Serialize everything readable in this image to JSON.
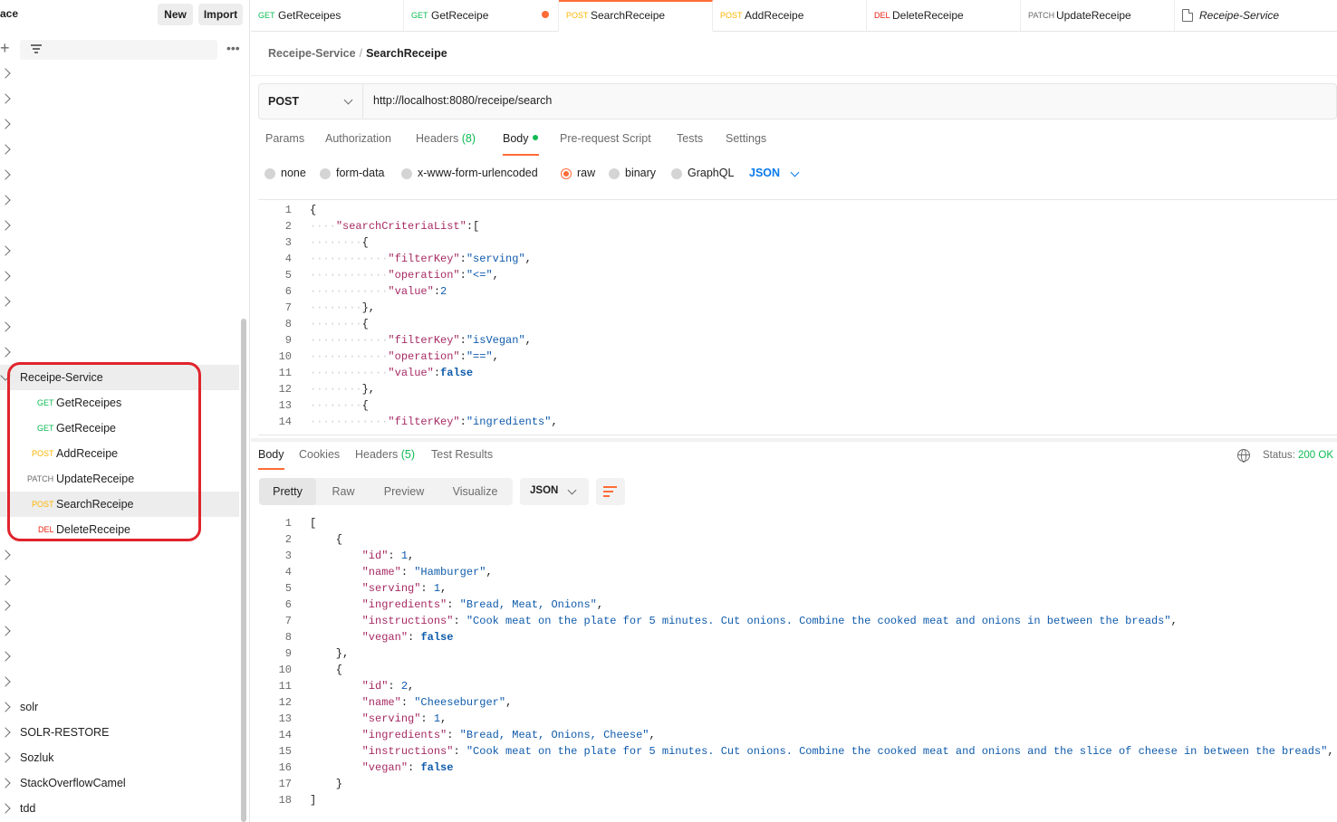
{
  "app": {
    "workspace_title": "ace",
    "new_label": "New",
    "import_label": "Import"
  },
  "sidebar": {
    "collection": {
      "name": "Receipe-Service",
      "requests": [
        {
          "method": "GET",
          "name": "GetReceipes"
        },
        {
          "method": "GET",
          "name": "GetReceipe"
        },
        {
          "method": "POST",
          "name": "AddReceipe"
        },
        {
          "method": "PATCH",
          "name": "UpdateReceipe"
        },
        {
          "method": "POST",
          "name": "SearchReceipe"
        },
        {
          "method": "DEL",
          "name": "DeleteReceipe"
        }
      ]
    },
    "other_collections": [
      "solr",
      "SOLR-RESTORE",
      "Sozluk",
      "StackOverflowCamel",
      "tdd"
    ]
  },
  "tabs": [
    {
      "method": "GET",
      "name": "GetReceipes"
    },
    {
      "method": "GET",
      "name": "GetReceipe"
    },
    {
      "method": "POST",
      "name": "SearchReceipe"
    },
    {
      "method": "POST",
      "name": "AddReceipe"
    },
    {
      "method": "DEL",
      "name": "DeleteReceipe"
    },
    {
      "method": "PATCH",
      "name": "UpdateReceipe"
    },
    {
      "method": "",
      "name": "Receipe-Service"
    }
  ],
  "request": {
    "breadcrumb_collection": "Receipe-Service",
    "breadcrumb_sep": "/",
    "breadcrumb_request": "SearchReceipe",
    "method": "POST",
    "url": "http://localhost:8080/receipe/search",
    "tabs": {
      "params": "Params",
      "authorization": "Authorization",
      "headers": "Headers",
      "headers_count": "(8)",
      "body": "Body",
      "prerequest": "Pre-request Script",
      "tests": "Tests",
      "settings": "Settings"
    },
    "body_types": {
      "none": "none",
      "form_data": "form-data",
      "urlencoded": "x-www-form-urlencoded",
      "raw": "raw",
      "binary": "binary",
      "graphql": "GraphQL",
      "format": "JSON"
    }
  },
  "response": {
    "tabs": {
      "body": "Body",
      "cookies": "Cookies",
      "headers": "Headers",
      "headers_count": "(5)",
      "test_results": "Test Results"
    },
    "status_label": "Status:",
    "status_value": "200 OK",
    "views": {
      "pretty": "Pretty",
      "raw": "Raw",
      "preview": "Preview",
      "visualize": "Visualize"
    },
    "format": "JSON"
  },
  "colors": {
    "accent": "#ff6c37",
    "get": "#0cbb52",
    "post": "#ffb400",
    "delete": "#eb2013",
    "annotation": "#e0242c"
  }
}
